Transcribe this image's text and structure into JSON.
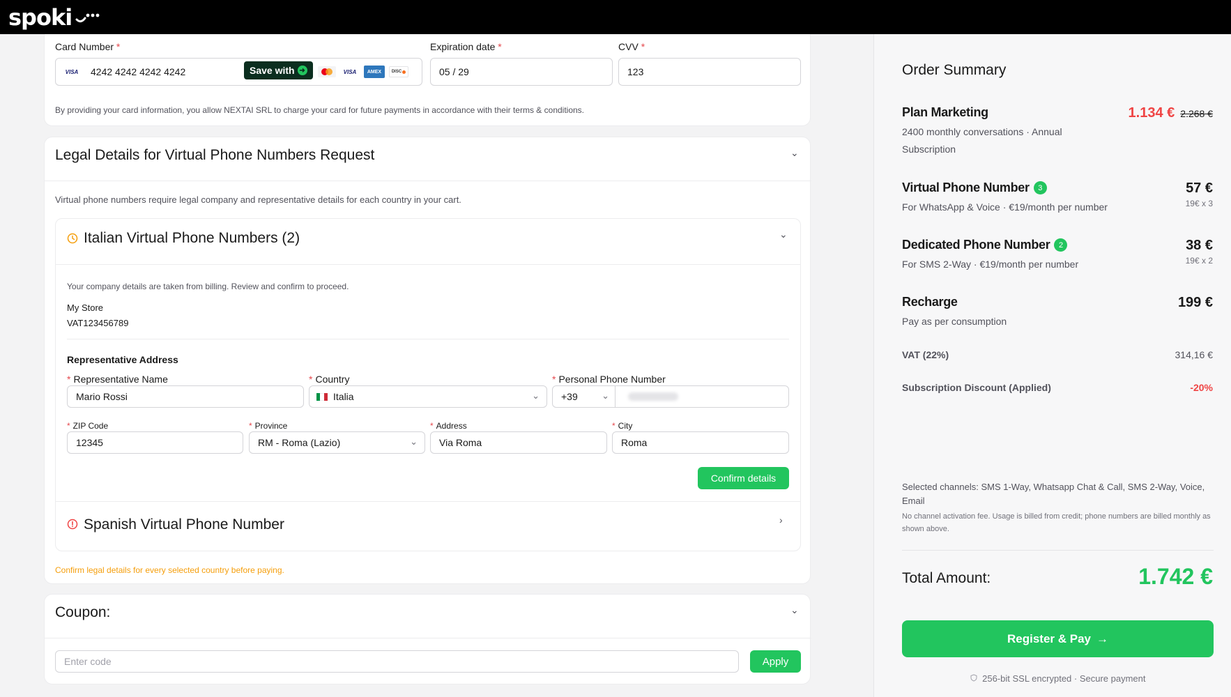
{
  "brand": {
    "name": "spoki"
  },
  "payment": {
    "card_label": "Card Number",
    "card_value": "4242 4242 4242 4242",
    "save_label": "Save with",
    "expiry_label": "Expiration date",
    "expiry_value": "05 / 29",
    "cvv_label": "CVV",
    "cvv_value": "123",
    "consent": "By providing your card information, you allow NEXTAI SRL to charge your card for future payments in accordance with their terms & conditions.",
    "brands": [
      "VISA",
      "VISA",
      "AMEX",
      "DISC"
    ]
  },
  "legal": {
    "title": "Legal Details for Virtual Phone Numbers Request",
    "intro": "Virtual phone numbers require legal company and representative details for each country in your cart.",
    "italian": {
      "title": "Italian Virtual Phone Numbers (2)",
      "note": "Your company details are taken from billing. Review and confirm to proceed.",
      "company_name": "My Store",
      "vat": "VAT123456789",
      "rep_heading": "Representative Address",
      "rep_name_label": "Representative Name",
      "rep_name_value": "Mario Rossi",
      "country_label": "Country",
      "country_value": "Italia",
      "phone_label": "Personal Phone Number",
      "phone_prefix": "+39",
      "zip_label": "ZIP Code",
      "zip_value": "12345",
      "province_label": "Province",
      "province_value": "RM - Roma (Lazio)",
      "address_label": "Address",
      "address_value": "Via Roma",
      "city_label": "City",
      "city_value": "Roma",
      "confirm_label": "Confirm details"
    },
    "spanish": {
      "title": "Spanish Virtual Phone Number"
    },
    "warning": "Confirm legal details for every selected country before paying."
  },
  "coupon": {
    "title": "Coupon:",
    "placeholder": "Enter code",
    "apply_label": "Apply"
  },
  "summary": {
    "title": "Order Summary",
    "items": [
      {
        "name": "Plan Marketing",
        "sub": "2400 monthly conversations · Annual Subscription",
        "price": "1.134 €",
        "old_price": "2.268 €"
      },
      {
        "name": "Virtual Phone Number",
        "badge": "3",
        "sub": "For WhatsApp & Voice · €19/month per number",
        "price": "57 €",
        "calc": "19€ x 3"
      },
      {
        "name": "Dedicated Phone Number",
        "badge": "2",
        "sub": "For SMS 2-Way · €19/month per number",
        "price": "38 €",
        "calc": "19€ x 2"
      },
      {
        "name": "Recharge",
        "sub": "Pay as per consumption",
        "price": "199 €"
      }
    ],
    "vat_label": "VAT (22%)",
    "vat_value": "314,16 €",
    "discount_label": "Subscription Discount (Applied)",
    "discount_value": "-20%",
    "channels": "Selected channels: SMS 1-Way, Whatsapp Chat & Call, SMS 2-Way, Voice, Email",
    "fee_note": "No channel activation fee. Usage is billed from credit; phone numbers are billed monthly as shown above.",
    "total_label": "Total Amount:",
    "total_value": "1.742 €",
    "pay_label": "Register & Pay",
    "secure": "256-bit SSL encrypted · Secure payment"
  },
  "colors": {
    "accent": "#22c55e",
    "price_red": "#ef4444",
    "warning": "#f59e0b"
  }
}
